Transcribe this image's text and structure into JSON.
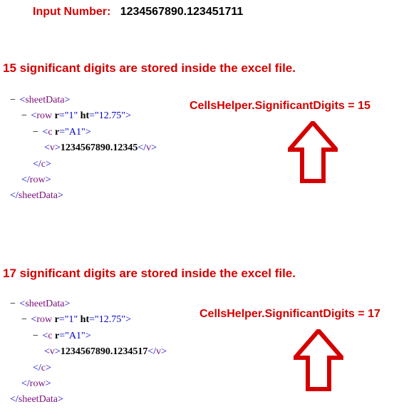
{
  "input": {
    "label": "Input Number:",
    "value": "1234567890.123451711"
  },
  "sections": [
    {
      "header": "15 significant digits are stored inside the excel file.",
      "annotation": "CellsHelper.SignificantDigits = 15",
      "xml": {
        "root_tag": "sheetData",
        "row_tag": "row",
        "row_attr_r": "r",
        "row_attr_r_val": "1",
        "row_attr_ht": "ht",
        "row_attr_ht_val": "12.75",
        "cell_tag": "c",
        "cell_attr_r": "r",
        "cell_attr_r_val": "A1",
        "value_tag": "v",
        "value_text": "1234567890.12345"
      }
    },
    {
      "header": "17 significant digits are stored inside the excel file.",
      "annotation": "CellsHelper.SignificantDigits = 17",
      "xml": {
        "root_tag": "sheetData",
        "row_tag": "row",
        "row_attr_r": "r",
        "row_attr_r_val": "1",
        "row_attr_ht": "ht",
        "row_attr_ht_val": "12.75",
        "cell_tag": "c",
        "cell_attr_r": "r",
        "cell_attr_r_val": "A1",
        "value_tag": "v",
        "value_text": "1234567890.1234517"
      }
    }
  ],
  "colors": {
    "accent": "#d40000",
    "tag": "#7b0f7b",
    "punct": "#0000c8"
  }
}
